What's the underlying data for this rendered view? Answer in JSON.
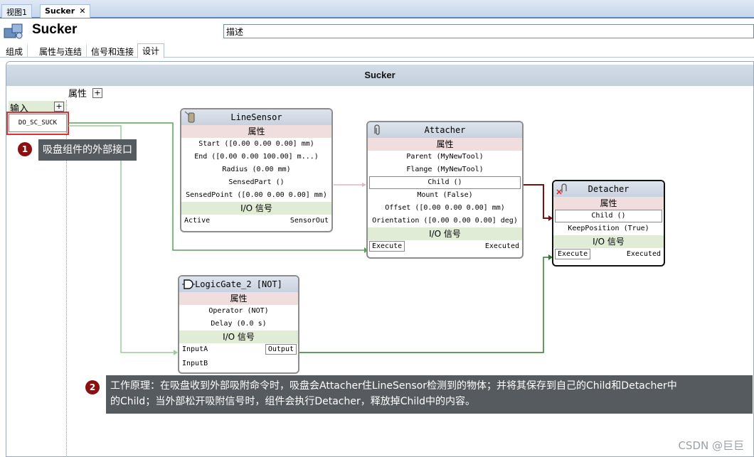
{
  "doc_tabs": [
    {
      "label": "视图1"
    },
    {
      "label": "Sucker",
      "close": "✕"
    }
  ],
  "header": {
    "title": "Sucker",
    "description_value": "描述"
  },
  "sub_tabs": [
    "组成",
    "属性与连结",
    "信号和连接",
    "设计"
  ],
  "canvas": {
    "title": "Sucker",
    "properties_label": "属性",
    "plus": "+",
    "input_label": "输入",
    "input_port": "DO_SC_SUCK"
  },
  "line_sensor": {
    "title": "LineSensor",
    "props_header": "属性",
    "props": [
      "Start ([0.00 0.00 0.00] mm)",
      "End ([0.00 0.00 100.00] m...)",
      "Radius (0.00 mm)",
      "SensedPart ()",
      "SensedPoint ([0.00 0.00 0.00] mm)"
    ],
    "io_header": "I/O 信号",
    "in": "Active",
    "out": "SensorOut"
  },
  "attacher": {
    "title": "Attacher",
    "props_header": "属性",
    "props": [
      "Parent (MyNewTool)",
      "Flange (MyNewTool)",
      "Child ()",
      "Mount (False)",
      "Offset ([0.00 0.00 0.00] mm)",
      "Orientation ([0.00 0.00 0.00] deg)"
    ],
    "io_header": "I/O 信号",
    "in": "Execute",
    "out": "Executed"
  },
  "detacher": {
    "title": "Detacher",
    "props_header": "属性",
    "props": [
      "Child ()",
      "KeepPosition (True)"
    ],
    "io_header": "I/O 信号",
    "in": "Execute",
    "out": "Executed"
  },
  "logic_gate": {
    "title": "LogicGate_2 [NOT]",
    "props_header": "属性",
    "props": [
      "Operator (NOT)",
      "Delay (0.0 s)"
    ],
    "io_header": "I/O 信号",
    "in_a": "InputA",
    "in_b": "InputB",
    "out": "Output"
  },
  "callouts": [
    {
      "num": "1",
      "text": "吸盘组件的外部接口"
    },
    {
      "num": "2",
      "line1": "工作原理：在吸盘收到外部吸附命令时，吸盘会Attacher住LineSensor检测到的物体；并将其保存到自己的Child和Detacher中",
      "line2": "的Child；当外部松开吸附信号时，组件会执行Detacher，释放掉Child中的内容。"
    }
  ],
  "watermark": "CSDN @巨巨",
  "colors": {
    "signal_wire": "#5aa05a",
    "property_wire": "#7a1010",
    "sensor_link": "#e4b4c0",
    "badge": "#8b1010"
  }
}
